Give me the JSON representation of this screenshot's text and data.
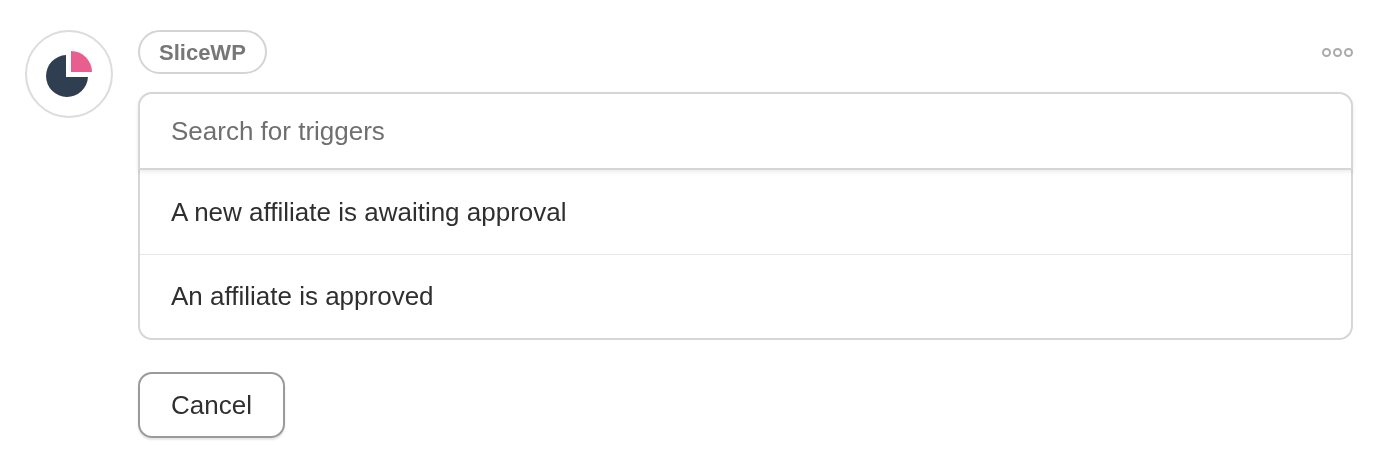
{
  "app_badge": "SliceWP",
  "search": {
    "placeholder": "Search for triggers"
  },
  "triggers": [
    {
      "label": "A new affiliate is awaiting approval"
    },
    {
      "label": "An affiliate is approved"
    }
  ],
  "cancel_button": "Cancel"
}
